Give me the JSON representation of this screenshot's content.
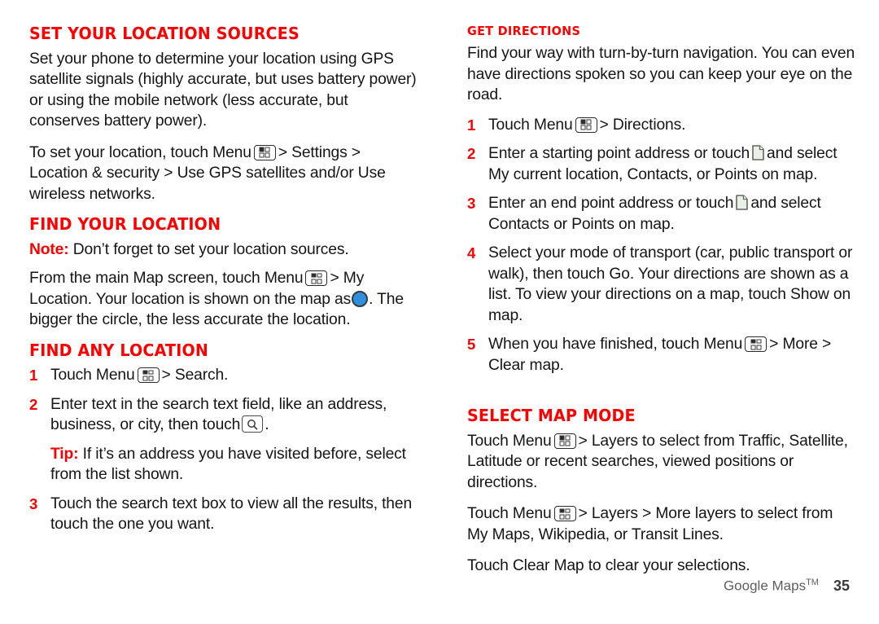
{
  "icons": {
    "menu": "menu-key-icon",
    "search": "search-key-icon",
    "location_dot": "my-location-dot-icon",
    "page": "page-picker-icon"
  },
  "left_column": {
    "section1": {
      "heading": "SET YOUR LOCATION SOURCES",
      "para1": "Set your phone to determine your location using GPS satellite signals (highly accurate, but uses battery power) or using the mobile network (less accurate, but conserves battery power).",
      "para2_before_icon": "To set your location, touch Menu",
      "para2_after_icon": "> Settings > Location & security > Use GPS satellites and/or Use wireless networks."
    },
    "section2": {
      "heading": "FIND YOUR LOCATION",
      "note_label": "Note:",
      "note_text": "Don’t forget to set your location sources.",
      "para_before_menu": "From the main Map screen, touch Menu",
      "para_after_menu": "> My Location. Your location is shown on the map as",
      "para_after_dot": ". The bigger the circle, the less accurate the location."
    },
    "section3": {
      "heading": "FIND ANY LOCATION",
      "steps": [
        {
          "num": "1",
          "before_icon": "Touch Menu",
          "icon": "menu",
          "after_icon": "> Search."
        },
        {
          "num": "2",
          "before_icon": "Enter text in the search text field, like an address, business, or city, then touch",
          "icon": "search",
          "after_icon": "."
        }
      ],
      "tip": {
        "label": "Tip:",
        "text": "If it’s an address you have visited before, select from the list shown."
      },
      "step3": {
        "num": "3",
        "text": "Touch the search text box to view all the results, then touch the one you want."
      }
    }
  },
  "right_column": {
    "section1": {
      "heading": "GET DIRECTIONS",
      "para1": "Find your way with turn-by-turn navigation. You can even have directions spoken so you can keep your eye on the road.",
      "steps": [
        {
          "num": "1",
          "before_icon": "Touch Menu",
          "icon": "menu",
          "after_icon": "> Directions."
        },
        {
          "num": "2",
          "before_icon": "Enter a starting point address or touch",
          "icon": "page",
          "after_icon": "and select My current location, Contacts, or Points on map."
        },
        {
          "num": "3",
          "before_icon": "Enter an end point address or touch",
          "icon": "page",
          "after_icon": "and select Contacts or Points on map."
        },
        {
          "num": "4",
          "before_icon": "Select your mode of transport (car, public transport or walk), then touch Go. Your directions are shown as a list. To view your directions on a map, touch Show on map.",
          "icon": "",
          "after_icon": ""
        },
        {
          "num": "5",
          "before_icon": "When you have finished, touch Menu",
          "icon": "menu",
          "after_icon": "> More > Clear map."
        }
      ]
    },
    "section2": {
      "heading": "SELECT MAP MODE",
      "para1_before_icon": "Touch Menu",
      "para1_after_icon": "> Layers to select from Traffic, Satellite, Latitude or recent searches, viewed positions or directions.",
      "para2_before_icon": "Touch Menu",
      "para2_after_icon": "> Layers > More layers to select from My Maps, Wikipedia, or Transit Lines.",
      "para3": "Touch Clear Map to clear your selections."
    }
  },
  "footer": {
    "product": "Google Maps",
    "trademark": "TM",
    "page_number": "35"
  },
  "colors": {
    "heading_red": "#FF0000",
    "body_text": "#151515",
    "footer_gray": "#5d5d5d",
    "location_blue": "#2f8fe0"
  }
}
